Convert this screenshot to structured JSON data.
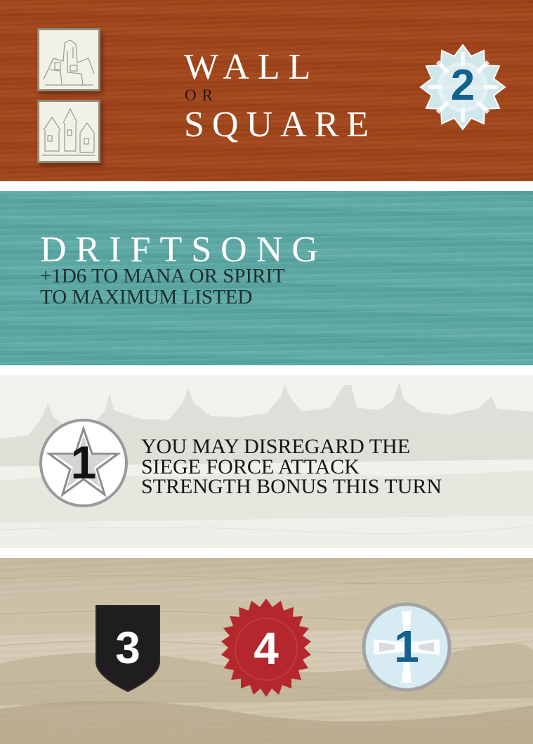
{
  "header": {
    "title_top": "WALL",
    "title_or": "OR",
    "title_bottom": "SQUARE",
    "color": "#a3461b",
    "tiles": [
      "city-wall-tile-icon",
      "city-square-tile-icon"
    ]
  },
  "spell": {
    "name": "DRIFTSONG",
    "effect_line_1": "+1D6 TO MANA OR SPIRIT",
    "effect_line_2": "TO MAXIMUM LISTED",
    "cost": "2",
    "cost_icon": "gear-burst-icon",
    "color": "#5aa8a4"
  },
  "ability": {
    "value": "1",
    "icon": "pentagram-star-icon",
    "text_line_1": "YOU MAY DISREGARD THE",
    "text_line_2": "SIEGE FORCE ATTACK",
    "text_line_3": "STRENGTH BONUS THIS TURN"
  },
  "stats": [
    {
      "value": "3",
      "icon": "shield-icon",
      "color": "#1f1d1f"
    },
    {
      "value": "4",
      "icon": "wax-seal-icon",
      "color": "#b3272d"
    },
    {
      "value": "1",
      "icon": "cross-circle-icon",
      "color": "#d6ecf2"
    }
  ]
}
